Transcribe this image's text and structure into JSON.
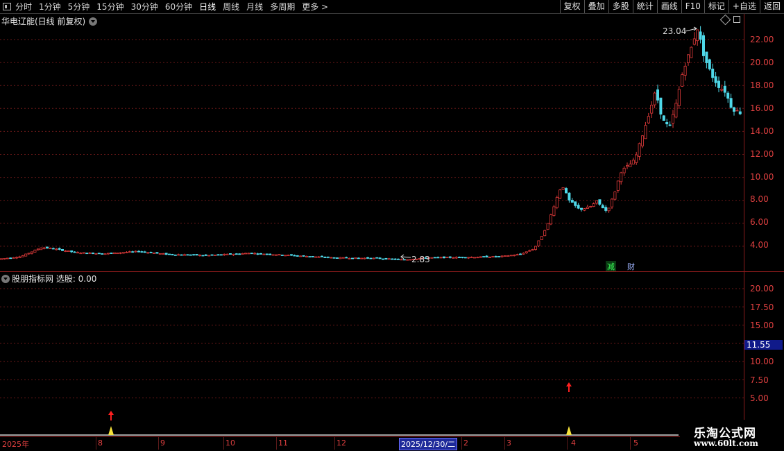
{
  "toolbar": {
    "periods": [
      "分时",
      "1分钟",
      "5分钟",
      "15分钟",
      "30分钟",
      "60分钟",
      "日线",
      "周线",
      "月线",
      "多周期",
      "更多 >"
    ],
    "active_period": "日线",
    "right_buttons": [
      "复权",
      "叠加",
      "多股",
      "统计",
      "画线",
      "F10",
      "标记",
      "+自选",
      "返回"
    ]
  },
  "main_panel": {
    "title": "华电辽能(日线 前复权)",
    "high_label": "23.04",
    "low_label": "2.83",
    "badges": {
      "reduce": "减",
      "finance": "财"
    },
    "axis_labels": [
      "22.00",
      "20.00",
      "18.00",
      "16.00",
      "14.00",
      "12.00",
      "10.00",
      "8.00",
      "6.00",
      "4.00"
    ]
  },
  "indicator_panel": {
    "title": "股朋指标网 选股: 0.00",
    "axis_labels": [
      "20.00",
      "17.50",
      "15.00",
      "12.50",
      "10.00",
      "7.50",
      "5.00"
    ],
    "cursor_value": "11.55"
  },
  "date_axis": {
    "labels": [
      "2025年",
      "8",
      "9",
      "10",
      "11",
      "12",
      "2",
      "3",
      "4",
      "5"
    ],
    "selected_date": "2025/12/30/二"
  },
  "watermark": {
    "title": "乐淘公式网",
    "url": "www.60lt.com"
  },
  "colors": {
    "up": "#e03a3a",
    "down": "#4fd8e8",
    "grid": "#6a1818",
    "axis_text": "#e04040",
    "signal_arrow": "#ff2020",
    "signal_spike": "#f5e23c"
  },
  "chart_data": {
    "type": "candlestick",
    "ylim": [
      2.3,
      23.5
    ],
    "price_path": [
      [
        0,
        2.9
      ],
      [
        30,
        3.1
      ],
      [
        45,
        3.5
      ],
      [
        60,
        3.9
      ],
      [
        75,
        3.8
      ],
      [
        85,
        3.7
      ],
      [
        110,
        3.45
      ],
      [
        150,
        3.35
      ],
      [
        200,
        3.55
      ],
      [
        240,
        3.3
      ],
      [
        300,
        3.2
      ],
      [
        360,
        3.4
      ],
      [
        420,
        3.2
      ],
      [
        480,
        3.0
      ],
      [
        540,
        2.95
      ],
      [
        582,
        2.83
      ],
      [
        620,
        3.0
      ],
      [
        680,
        3.05
      ],
      [
        720,
        3.1
      ],
      [
        750,
        3.3
      ],
      [
        770,
        3.8
      ],
      [
        780,
        4.8
      ],
      [
        790,
        6.0
      ],
      [
        800,
        7.8
      ],
      [
        810,
        9.4
      ],
      [
        820,
        8.0
      ],
      [
        835,
        7.2
      ],
      [
        850,
        7.4
      ],
      [
        860,
        7.9
      ],
      [
        875,
        7.0
      ],
      [
        885,
        8.5
      ],
      [
        895,
        10.5
      ],
      [
        905,
        11.0
      ],
      [
        915,
        11.5
      ],
      [
        925,
        13.5
      ],
      [
        935,
        15.5
      ],
      [
        945,
        17.5
      ],
      [
        955,
        15.0
      ],
      [
        965,
        14.3
      ],
      [
        975,
        16.5
      ],
      [
        985,
        19.5
      ],
      [
        995,
        21.0
      ],
      [
        1005,
        23.04
      ],
      [
        1015,
        20.5
      ],
      [
        1025,
        19.0
      ],
      [
        1035,
        18.0
      ],
      [
        1045,
        17.5
      ],
      [
        1055,
        16.0
      ],
      [
        1068,
        15.6
      ]
    ],
    "signals": [
      {
        "x": 160,
        "label": "buy"
      },
      {
        "x": 820,
        "label": "buy"
      }
    ]
  }
}
